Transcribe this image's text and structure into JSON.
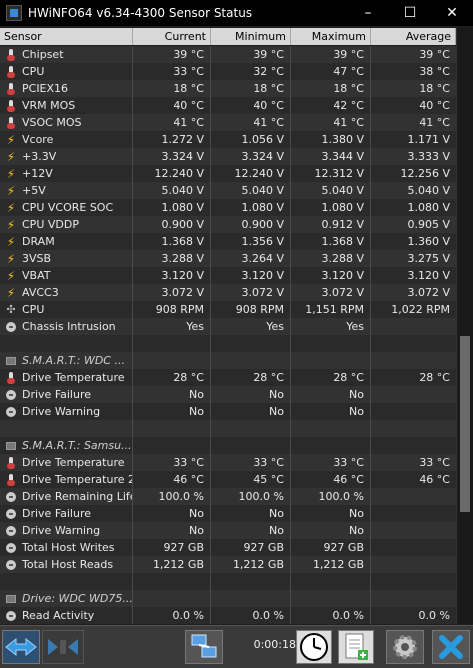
{
  "window": {
    "title": "HWiNFO64 v6.34-4300 Sensor Status",
    "minimize": "–",
    "maximize": "☐",
    "close": "✕"
  },
  "columns": [
    "Sensor",
    "Current",
    "Minimum",
    "Maximum",
    "Average"
  ],
  "rows": [
    {
      "icon": "temp",
      "label": "Chipset",
      "cur": "39 °C",
      "min": "39 °C",
      "max": "39 °C",
      "avg": "39 °C"
    },
    {
      "icon": "temp",
      "label": "CPU",
      "cur": "33 °C",
      "min": "32 °C",
      "max": "47 °C",
      "avg": "38 °C"
    },
    {
      "icon": "temp",
      "label": "PCIEX16",
      "cur": "18 °C",
      "min": "18 °C",
      "max": "18 °C",
      "avg": "18 °C"
    },
    {
      "icon": "temp",
      "label": "VRM MOS",
      "cur": "40 °C",
      "min": "40 °C",
      "max": "42 °C",
      "avg": "40 °C"
    },
    {
      "icon": "temp",
      "label": "VSOC MOS",
      "cur": "41 °C",
      "min": "41 °C",
      "max": "41 °C",
      "avg": "41 °C"
    },
    {
      "icon": "volt",
      "label": "Vcore",
      "cur": "1.272 V",
      "min": "1.056 V",
      "max": "1.380 V",
      "avg": "1.171 V"
    },
    {
      "icon": "volt",
      "label": "+3.3V",
      "cur": "3.324 V",
      "min": "3.324 V",
      "max": "3.344 V",
      "avg": "3.333 V"
    },
    {
      "icon": "volt",
      "label": "+12V",
      "cur": "12.240 V",
      "min": "12.240 V",
      "max": "12.312 V",
      "avg": "12.256 V"
    },
    {
      "icon": "volt",
      "label": "+5V",
      "cur": "5.040 V",
      "min": "5.040 V",
      "max": "5.040 V",
      "avg": "5.040 V"
    },
    {
      "icon": "volt",
      "label": "CPU VCORE SOC",
      "cur": "1.080 V",
      "min": "1.080 V",
      "max": "1.080 V",
      "avg": "1.080 V"
    },
    {
      "icon": "volt",
      "label": "CPU VDDP",
      "cur": "0.900 V",
      "min": "0.900 V",
      "max": "0.912 V",
      "avg": "0.905 V"
    },
    {
      "icon": "volt",
      "label": "DRAM",
      "cur": "1.368 V",
      "min": "1.356 V",
      "max": "1.368 V",
      "avg": "1.360 V"
    },
    {
      "icon": "volt",
      "label": "3VSB",
      "cur": "3.288 V",
      "min": "3.264 V",
      "max": "3.288 V",
      "avg": "3.275 V"
    },
    {
      "icon": "volt",
      "label": "VBAT",
      "cur": "3.120 V",
      "min": "3.120 V",
      "max": "3.120 V",
      "avg": "3.120 V"
    },
    {
      "icon": "volt",
      "label": "AVCC3",
      "cur": "3.072 V",
      "min": "3.072 V",
      "max": "3.072 V",
      "avg": "3.072 V"
    },
    {
      "icon": "fan",
      "label": "CPU",
      "cur": "908 RPM",
      "min": "908 RPM",
      "max": "1,151 RPM",
      "avg": "1,022 RPM"
    },
    {
      "icon": "disc",
      "label": "Chassis Intrusion",
      "cur": "Yes",
      "min": "Yes",
      "max": "Yes",
      "avg": ""
    },
    {
      "icon": "",
      "label": "",
      "cur": "",
      "min": "",
      "max": "",
      "avg": ""
    },
    {
      "icon": "chip",
      "label": "S.M.A.R.T.: WDC ...",
      "cur": "",
      "min": "",
      "max": "",
      "avg": "",
      "group": true
    },
    {
      "icon": "temp",
      "label": "Drive Temperature",
      "cur": "28 °C",
      "min": "28 °C",
      "max": "28 °C",
      "avg": "28 °C"
    },
    {
      "icon": "disc",
      "label": "Drive Failure",
      "cur": "No",
      "min": "No",
      "max": "No",
      "avg": ""
    },
    {
      "icon": "disc",
      "label": "Drive Warning",
      "cur": "No",
      "min": "No",
      "max": "No",
      "avg": ""
    },
    {
      "icon": "",
      "label": "",
      "cur": "",
      "min": "",
      "max": "",
      "avg": ""
    },
    {
      "icon": "chip",
      "label": "S.M.A.R.T.: Samsu...",
      "cur": "",
      "min": "",
      "max": "",
      "avg": "",
      "group": true
    },
    {
      "icon": "temp",
      "label": "Drive Temperature",
      "cur": "33 °C",
      "min": "33 °C",
      "max": "33 °C",
      "avg": "33 °C"
    },
    {
      "icon": "temp",
      "label": "Drive Temperature 2",
      "cur": "46 °C",
      "min": "45 °C",
      "max": "46 °C",
      "avg": "46 °C"
    },
    {
      "icon": "disc",
      "label": "Drive Remaining Life",
      "cur": "100.0 %",
      "min": "100.0 %",
      "max": "100.0 %",
      "avg": ""
    },
    {
      "icon": "disc",
      "label": "Drive Failure",
      "cur": "No",
      "min": "No",
      "max": "No",
      "avg": ""
    },
    {
      "icon": "disc",
      "label": "Drive Warning",
      "cur": "No",
      "min": "No",
      "max": "No",
      "avg": ""
    },
    {
      "icon": "disc",
      "label": "Total Host Writes",
      "cur": "927 GB",
      "min": "927 GB",
      "max": "927 GB",
      "avg": ""
    },
    {
      "icon": "disc",
      "label": "Total Host Reads",
      "cur": "1,212 GB",
      "min": "1,212 GB",
      "max": "1,212 GB",
      "avg": ""
    },
    {
      "icon": "",
      "label": "",
      "cur": "",
      "min": "",
      "max": "",
      "avg": ""
    },
    {
      "icon": "chip",
      "label": "Drive: WDC WD75...",
      "cur": "",
      "min": "",
      "max": "",
      "avg": "",
      "group": true
    },
    {
      "icon": "disc",
      "label": "Read Activity",
      "cur": "0.0 %",
      "min": "0.0 %",
      "max": "0.0 %",
      "avg": "0.0 %"
    }
  ],
  "statusbar": {
    "elapsed": "0:00:18"
  },
  "colors": {
    "header_bg": "#d8d8d8",
    "row_even": "#323232",
    "row_odd": "#2a2a2a",
    "accent_blue": "#3a8ad8",
    "close_x": "#2a9ae0"
  }
}
